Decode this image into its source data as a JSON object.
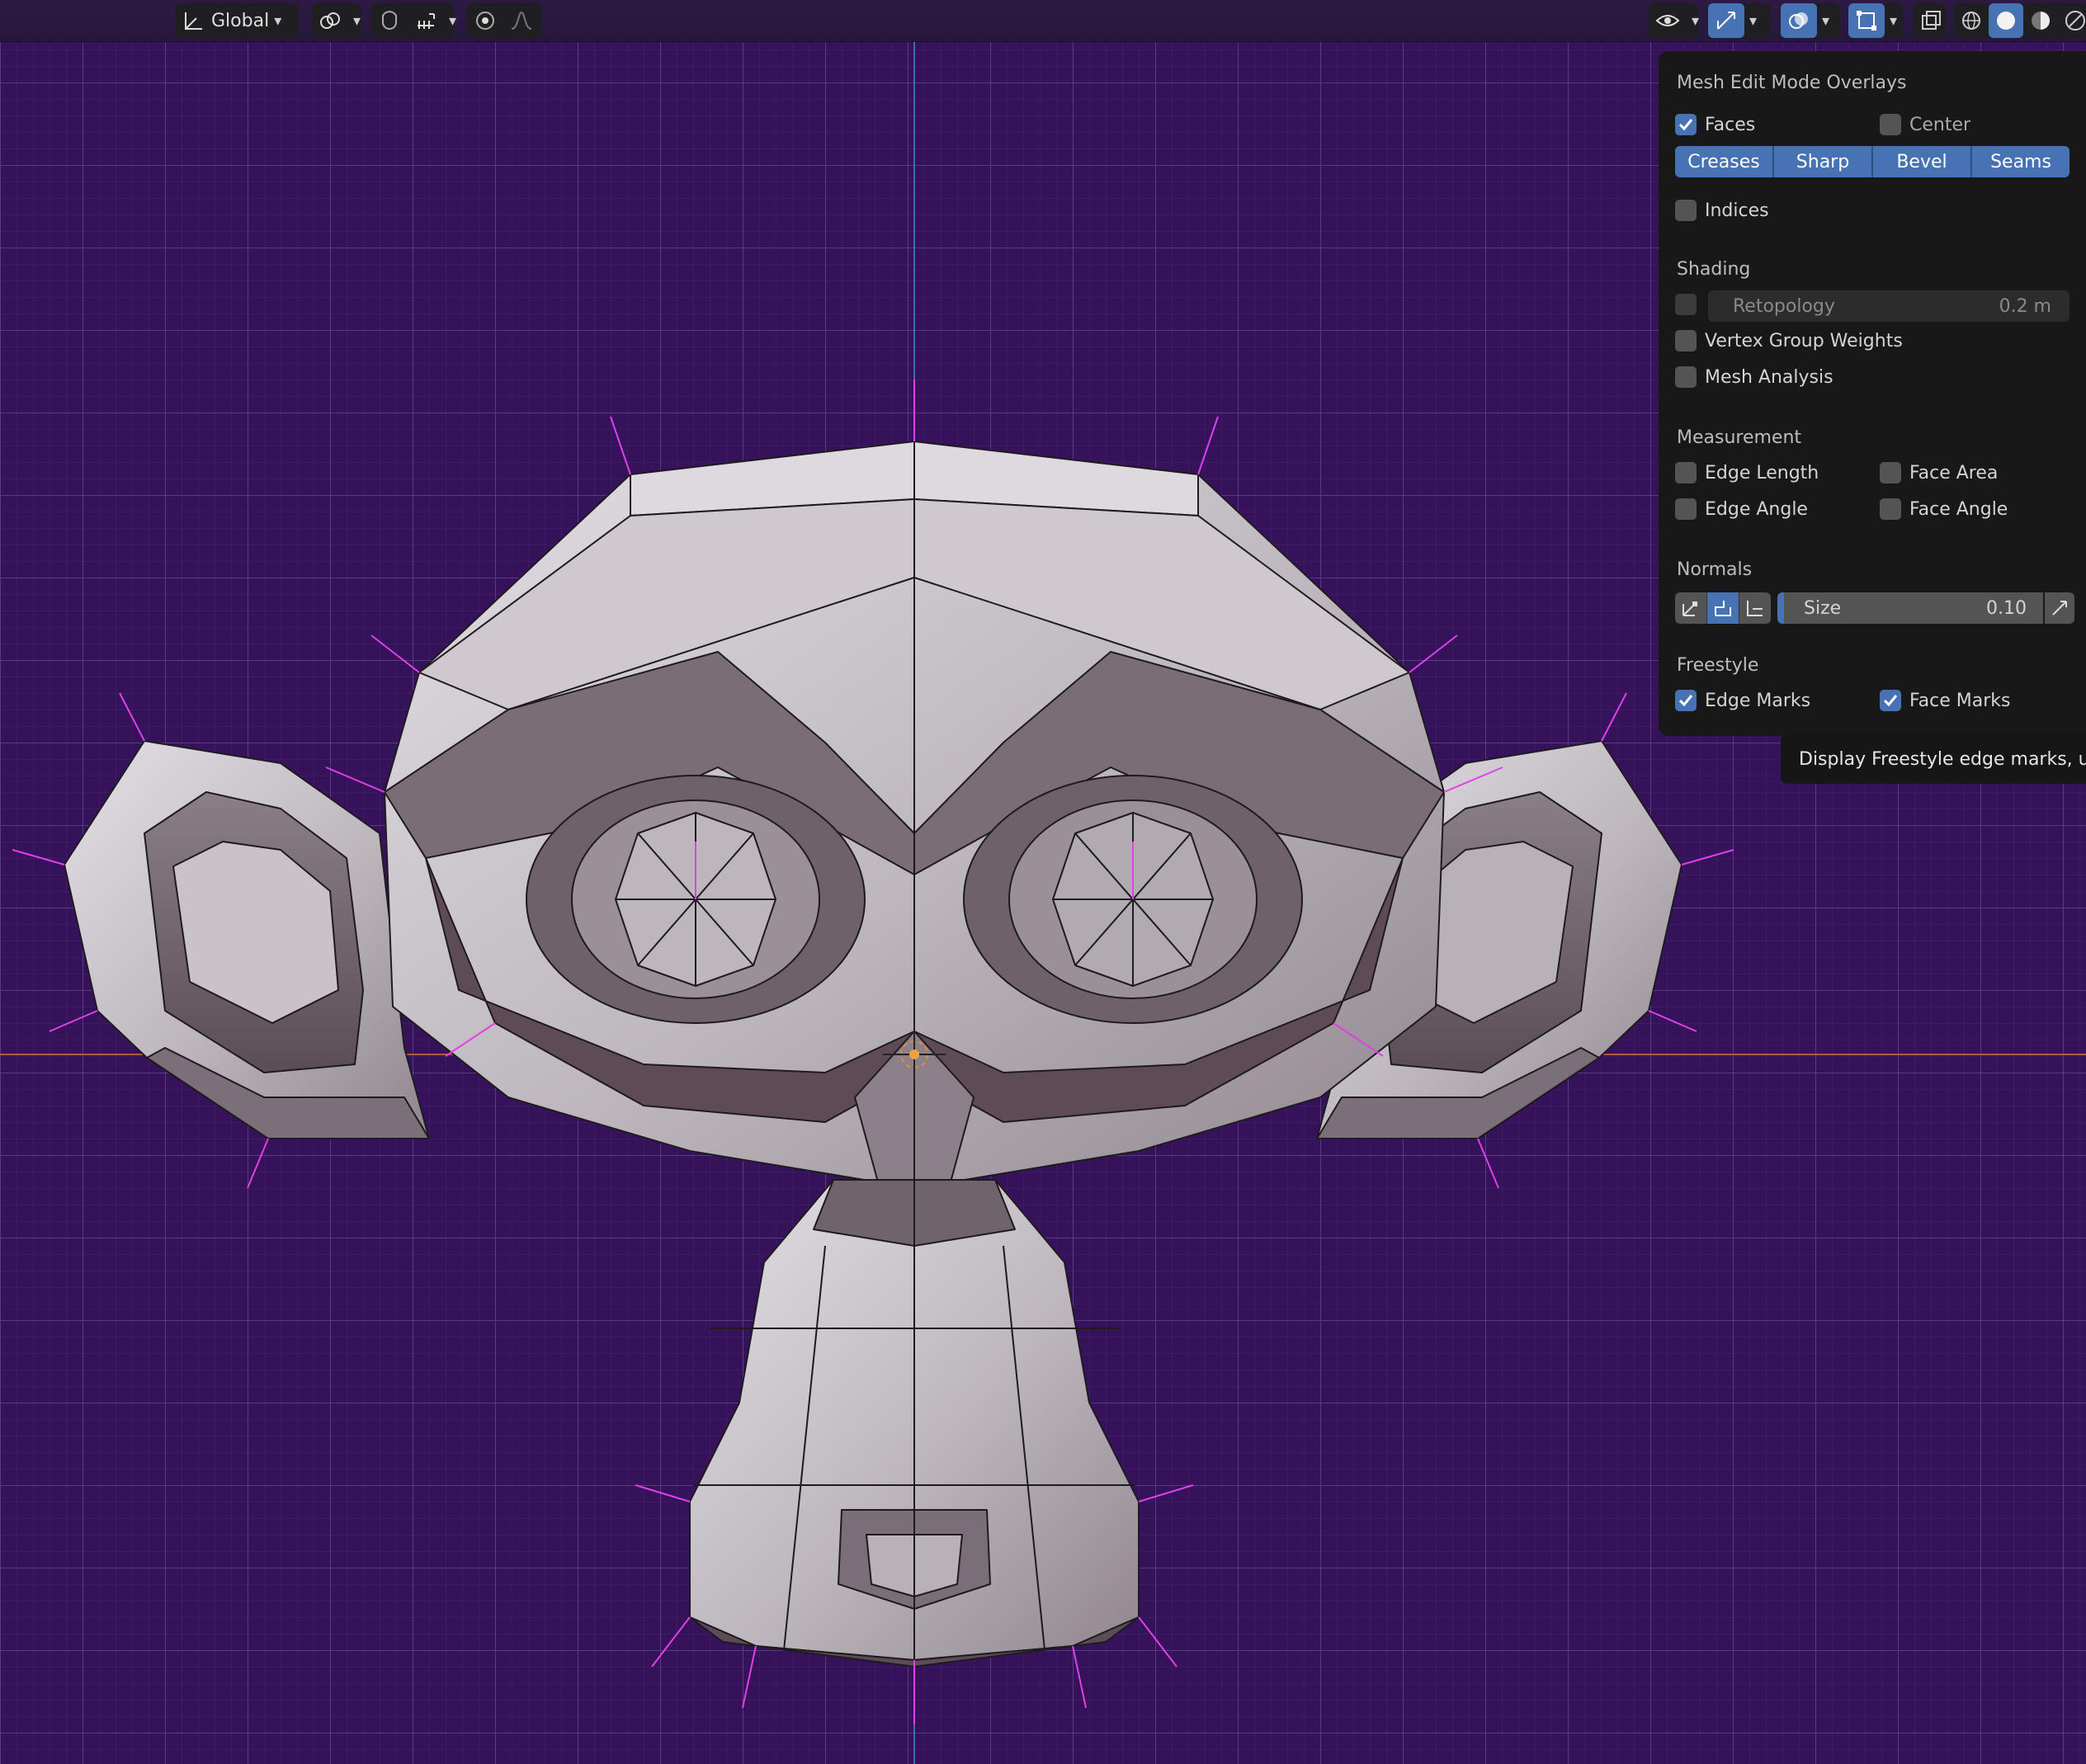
{
  "header": {
    "orientation_label": "Global"
  },
  "overlay_panel": {
    "title": "Mesh Edit Mode Overlays",
    "faces": {
      "label": "Faces",
      "checked": true
    },
    "center": {
      "label": "Center",
      "checked": false
    },
    "edge_types": [
      "Creases",
      "Sharp",
      "Bevel",
      "Seams"
    ],
    "indices": {
      "label": "Indices",
      "checked": false
    },
    "shading": {
      "title": "Shading",
      "retopology_label": "Retopology",
      "retopology_value": "0.2 m",
      "vertex_group_weights": "Vertex Group Weights",
      "mesh_analysis": "Mesh Analysis"
    },
    "measurement": {
      "title": "Measurement",
      "edge_length": "Edge Length",
      "face_area": "Face Area",
      "edge_angle": "Edge Angle",
      "face_angle": "Face Angle"
    },
    "normals": {
      "title": "Normals",
      "size_label": "Size",
      "size_value": "0.10"
    },
    "freestyle": {
      "title": "Freestyle",
      "edge_marks": {
        "label": "Edge Marks",
        "checked": true
      },
      "face_marks": {
        "label": "Face Marks",
        "checked": true
      }
    }
  },
  "tooltip": "Display Freestyle edge marks, use",
  "colors": {
    "viewport_bg": "#35125a",
    "grid": "#5a3a85",
    "accent": "#4772b3",
    "normals": "#e040e8",
    "x_axis": "#b05c3a",
    "y_axis": "#3d6fb0"
  }
}
